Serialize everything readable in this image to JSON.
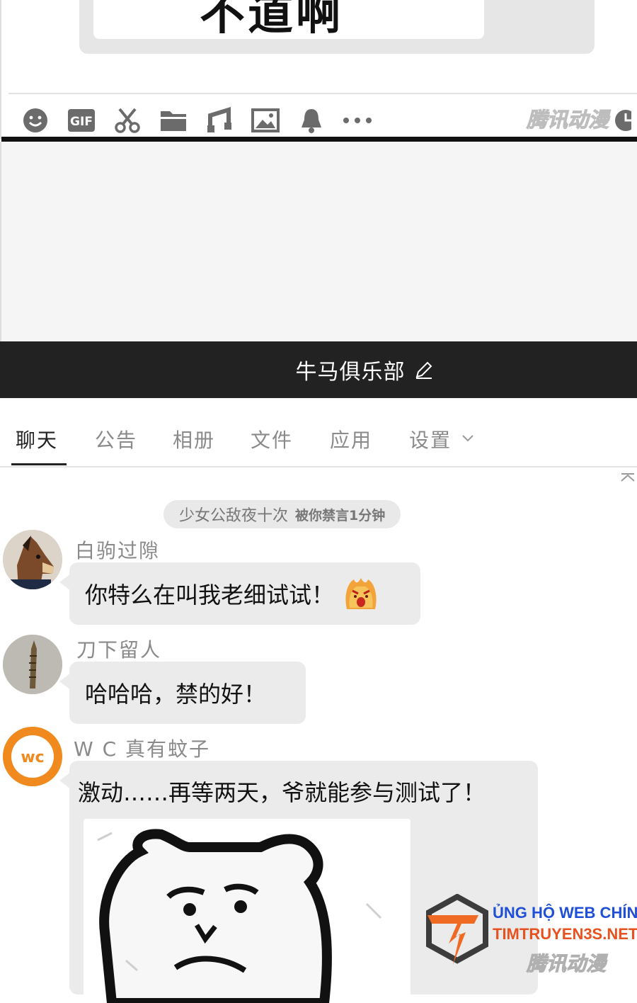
{
  "top_panel": {
    "bubble_text": "不道啊",
    "toolbar_icons": [
      "emoji-icon",
      "gif-icon",
      "scissors-icon",
      "folder-icon",
      "music-icon",
      "image-icon",
      "bell-icon",
      "more-icon"
    ],
    "gif_label": "GIF",
    "watermark": "腾讯动漫"
  },
  "group": {
    "title": "牛马俱乐部"
  },
  "tabs": [
    {
      "label": "聊天",
      "active": true
    },
    {
      "label": "公告",
      "active": false
    },
    {
      "label": "相册",
      "active": false
    },
    {
      "label": "文件",
      "active": false
    },
    {
      "label": "应用",
      "active": false
    },
    {
      "label": "设置",
      "active": false
    }
  ],
  "system_message": {
    "name": "少女公敌夜十次",
    "note": "被你禁言1分钟"
  },
  "messages": [
    {
      "sender": "白驹过隙",
      "text": "你特么在叫我老细试试！",
      "has_emoji": true
    },
    {
      "sender": "刀下留人",
      "text": "哈哈哈，禁的好！"
    },
    {
      "sender": "W C 真有蚊子",
      "avatar_text": "wc",
      "text": "激动……再等两天，爷就能参与测试了！",
      "has_image": true
    }
  ],
  "watermark_bottom": "腾讯动漫",
  "support_banner": {
    "line1": "ỦNG HỘ WEB CHÍNH",
    "line2": "TIMTRUYEN3S.NET"
  },
  "colors": {
    "header_bg": "#222222",
    "bubble_bg": "#ebebeb",
    "support_blue": "#1f4fd6",
    "support_orange": "#e8521f"
  }
}
